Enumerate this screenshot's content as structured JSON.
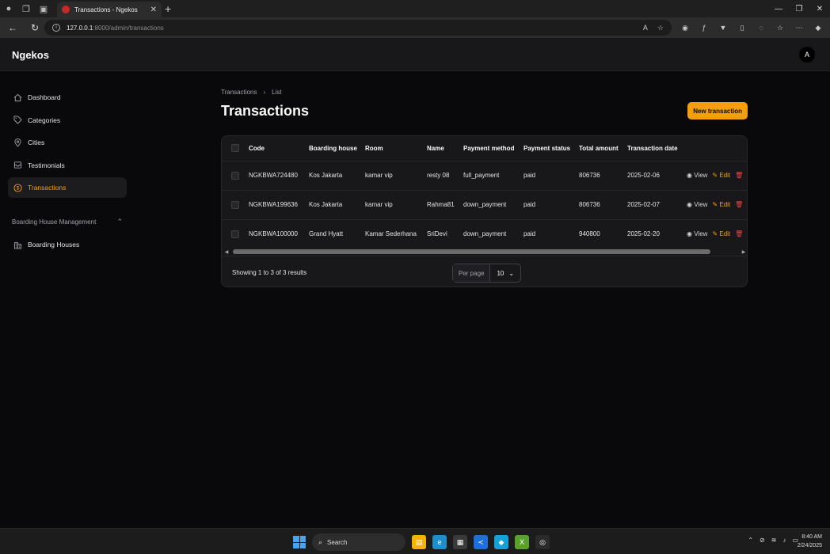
{
  "browser": {
    "tab_title": "Transactions - Ngekos",
    "url_host": "127.0.0.1",
    "url_path": ":8000/admin/transactions"
  },
  "app": {
    "brand": "Ngekos",
    "avatar_initial": "A"
  },
  "sidebar": {
    "items": [
      {
        "label": "Dashboard",
        "icon": "home-icon"
      },
      {
        "label": "Categories",
        "icon": "tag-icon"
      },
      {
        "label": "Cities",
        "icon": "map-pin-icon"
      },
      {
        "label": "Testimonials",
        "icon": "inbox-icon"
      },
      {
        "label": "Transactions",
        "icon": "dollar-icon",
        "active": true
      }
    ],
    "group_label": "Boarding House Management",
    "group_items": [
      {
        "label": "Boarding Houses",
        "icon": "building-icon"
      }
    ]
  },
  "page": {
    "breadcrumb_root": "Transactions",
    "breadcrumb_current": "List",
    "title": "Transactions",
    "new_button": "New transaction"
  },
  "table": {
    "headers": [
      "Code",
      "Boarding house",
      "Room",
      "Name",
      "Payment method",
      "Payment status",
      "Total amount",
      "Transaction date"
    ],
    "rows": [
      [
        "NGKBWA724480",
        "Kos Jakarta",
        "kamar vip",
        "resty 08",
        "full_payment",
        "paid",
        "806736",
        "2025-02-06"
      ],
      [
        "NGKBWA199636",
        "Kos Jakarta",
        "kamar vip",
        "Rahma81",
        "down_payment",
        "paid",
        "806736",
        "2025-02-07"
      ],
      [
        "NGKBWA100000",
        "Grand Hyatt",
        "Kamar Sederhana",
        "SriDevi",
        "down_payment",
        "paid",
        "940800",
        "2025-02-20"
      ]
    ],
    "action_view": "View",
    "action_edit": "Edit",
    "summary": "Showing 1 to 3 of 3 results",
    "per_page_label": "Per page",
    "per_page_value": "10"
  },
  "taskbar": {
    "search": "Search",
    "time": "8:40 AM",
    "date": "2/24/2025"
  },
  "colors": {
    "accent": "#f59e0b",
    "danger": "#ef4444",
    "surface": "#18181b",
    "background": "#09090b"
  }
}
